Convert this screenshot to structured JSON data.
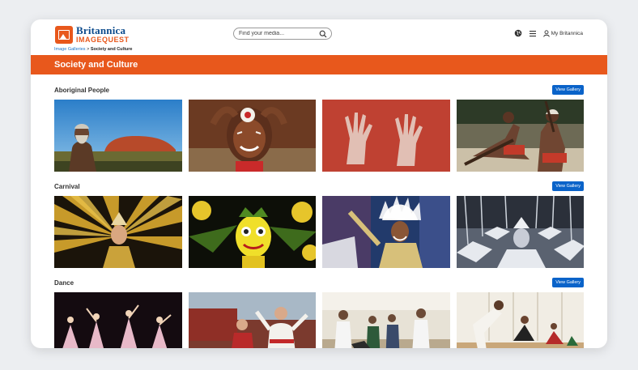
{
  "header": {
    "brand": "Britannica",
    "product": "IMAGEQUEST",
    "search_placeholder": "Find your media...",
    "account_label": "My Britannica"
  },
  "breadcrumb": {
    "parent": "Image Galleries",
    "separator": ">",
    "current": "Society and Culture"
  },
  "page_title": "Society and Culture",
  "view_gallery_label": "View Gallery",
  "sections": [
    {
      "title": "Aboriginal People"
    },
    {
      "title": "Carnival"
    },
    {
      "title": "Dance"
    }
  ],
  "colors": {
    "accent": "#e8581c",
    "brand_blue": "#0a4a8c",
    "button_blue": "#0a63c9"
  }
}
